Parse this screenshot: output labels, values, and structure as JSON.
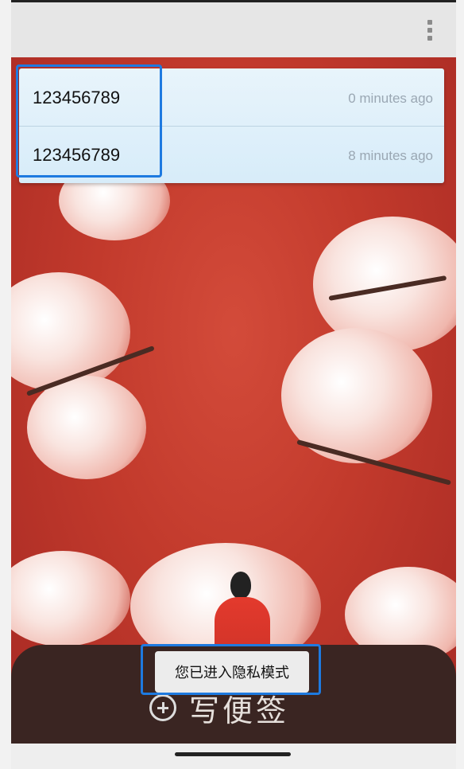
{
  "appbar": {
    "menu_icon": "more-vertical-icon"
  },
  "notes": [
    {
      "text": "123456789",
      "time": "0 minutes ago"
    },
    {
      "text": "123456789",
      "time": "8 minutes ago"
    }
  ],
  "bottom": {
    "add_icon": "plus-circle-icon",
    "write_label": "写便签"
  },
  "toast": {
    "message": "您已进入隐私模式"
  },
  "colors": {
    "accent_highlight": "#1e7ae0",
    "card_bg": "#e8f4fb",
    "background_red": "#c23a2c"
  }
}
